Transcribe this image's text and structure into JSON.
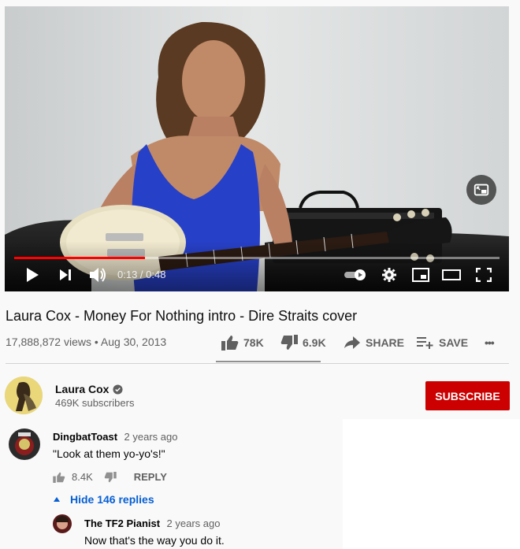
{
  "player": {
    "time": "0:13 / 0:48",
    "progress_fraction": 0.27
  },
  "video": {
    "title": "Laura Cox - Money For Nothing intro - Dire Straits cover",
    "views": "17,888,872 views",
    "separator": "•",
    "date": "Aug 30, 2013",
    "likes": "78K",
    "dislikes": "6.9K",
    "share_label": "SHARE",
    "save_label": "SAVE",
    "more_label": "•••"
  },
  "channel": {
    "name": "Laura Cox",
    "subscribers": "469K subscribers",
    "subscribe_label": "SUBSCRIBE"
  },
  "comments": [
    {
      "author": "DingbatToast",
      "time": "2 years ago",
      "text": "\"Look at them yo-yo's!\"",
      "likes": "8.4K",
      "reply_label": "REPLY",
      "hide_replies_label": "Hide 146 replies"
    },
    {
      "author": "The TF2 Pianist",
      "time": "2 years ago",
      "text": "Now that's the way you do it."
    }
  ],
  "colors": {
    "progress": "#ff0000",
    "subscribe": "#cc0000",
    "link": "#065fd4"
  }
}
